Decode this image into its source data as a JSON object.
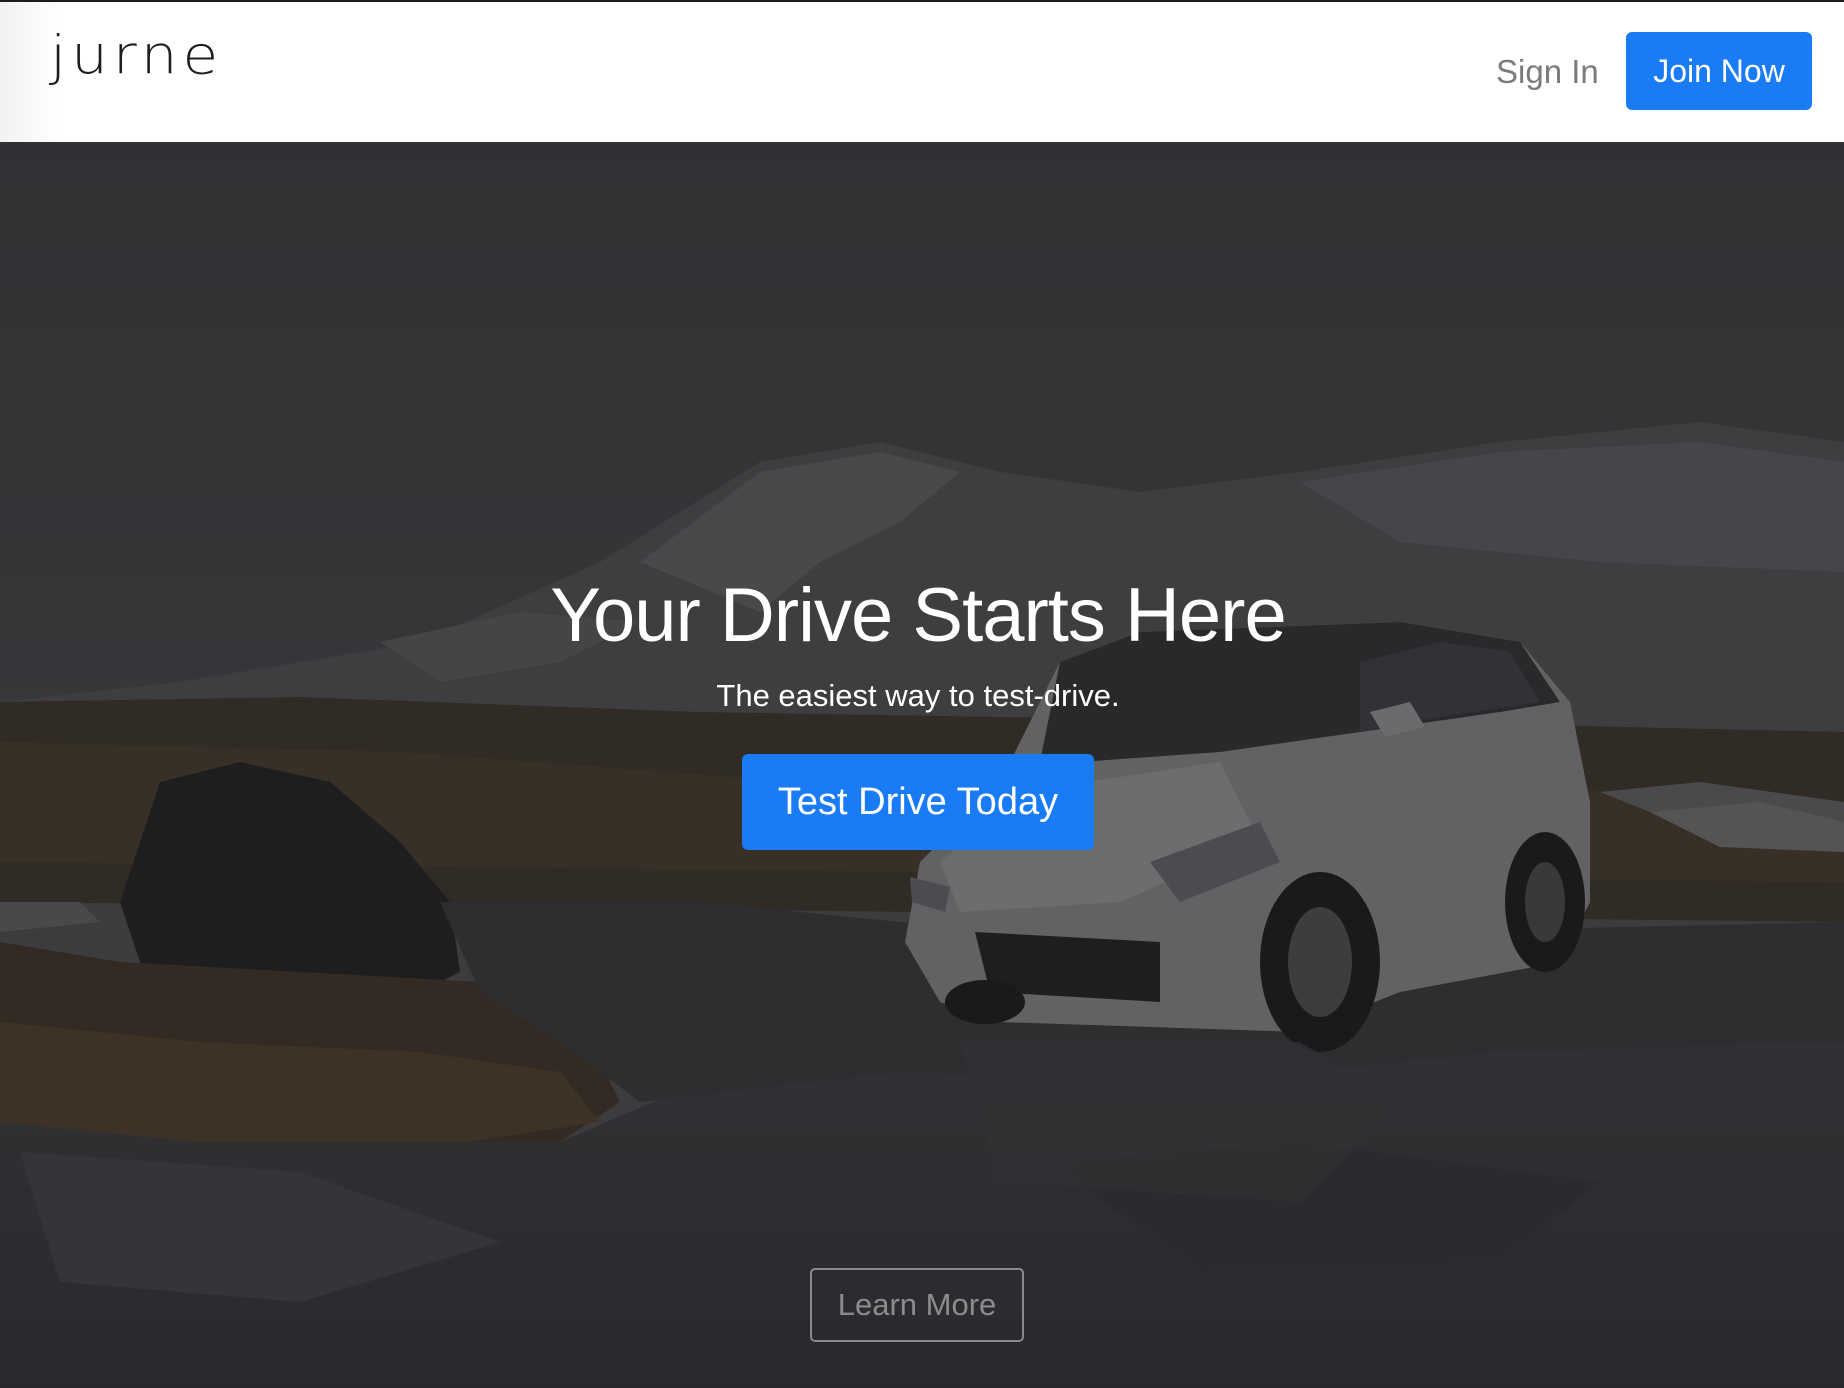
{
  "navbar": {
    "brand": "jurne",
    "signin_label": "Sign In",
    "join_label": "Join Now"
  },
  "hero": {
    "title": "Your Drive Starts Here",
    "subtitle": "The easiest way to test-drive.",
    "cta_label": "Test Drive Today",
    "learn_more_label": "Learn More",
    "image": "car-on-icy-landscape"
  },
  "colors": {
    "accent": "#1a7cf5",
    "overlay": "#2e2e32"
  }
}
